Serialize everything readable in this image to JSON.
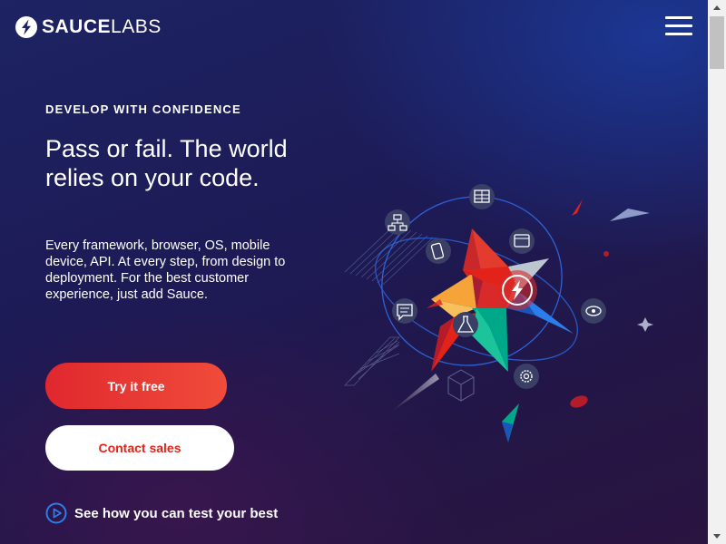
{
  "header": {
    "logo_bold": "SAUCE",
    "logo_light": "LABS",
    "logo_icon": "sauce-bolt-icon",
    "menu_icon": "hamburger-menu-icon"
  },
  "hero": {
    "eyebrow": "DEVELOP WITH CONFIDENCE",
    "headline": "Pass or fail. The world relies on your code.",
    "body": "Every framework, browser, OS, mobile device, API. At every step, from design to deployment. For the best customer experience, just add Sauce.",
    "primary_cta": "Try it free",
    "secondary_cta": "Contact sales",
    "video_link": "See how you can test your best",
    "video_icon": "play-circle-icon"
  },
  "colors": {
    "primary_red": "#e2231a",
    "background_navy": "#1d1a55",
    "accent_blue": "#2b7de9",
    "white": "#ffffff"
  },
  "illustration": {
    "icons": [
      "table-icon",
      "flowchart-icon",
      "mobile-icon",
      "window-icon",
      "chat-icon",
      "flask-icon",
      "eye-icon",
      "gear-icon"
    ]
  },
  "scrollbar": {
    "up_icon": "scroll-up-arrow-icon",
    "down_icon": "scroll-down-arrow-icon"
  }
}
